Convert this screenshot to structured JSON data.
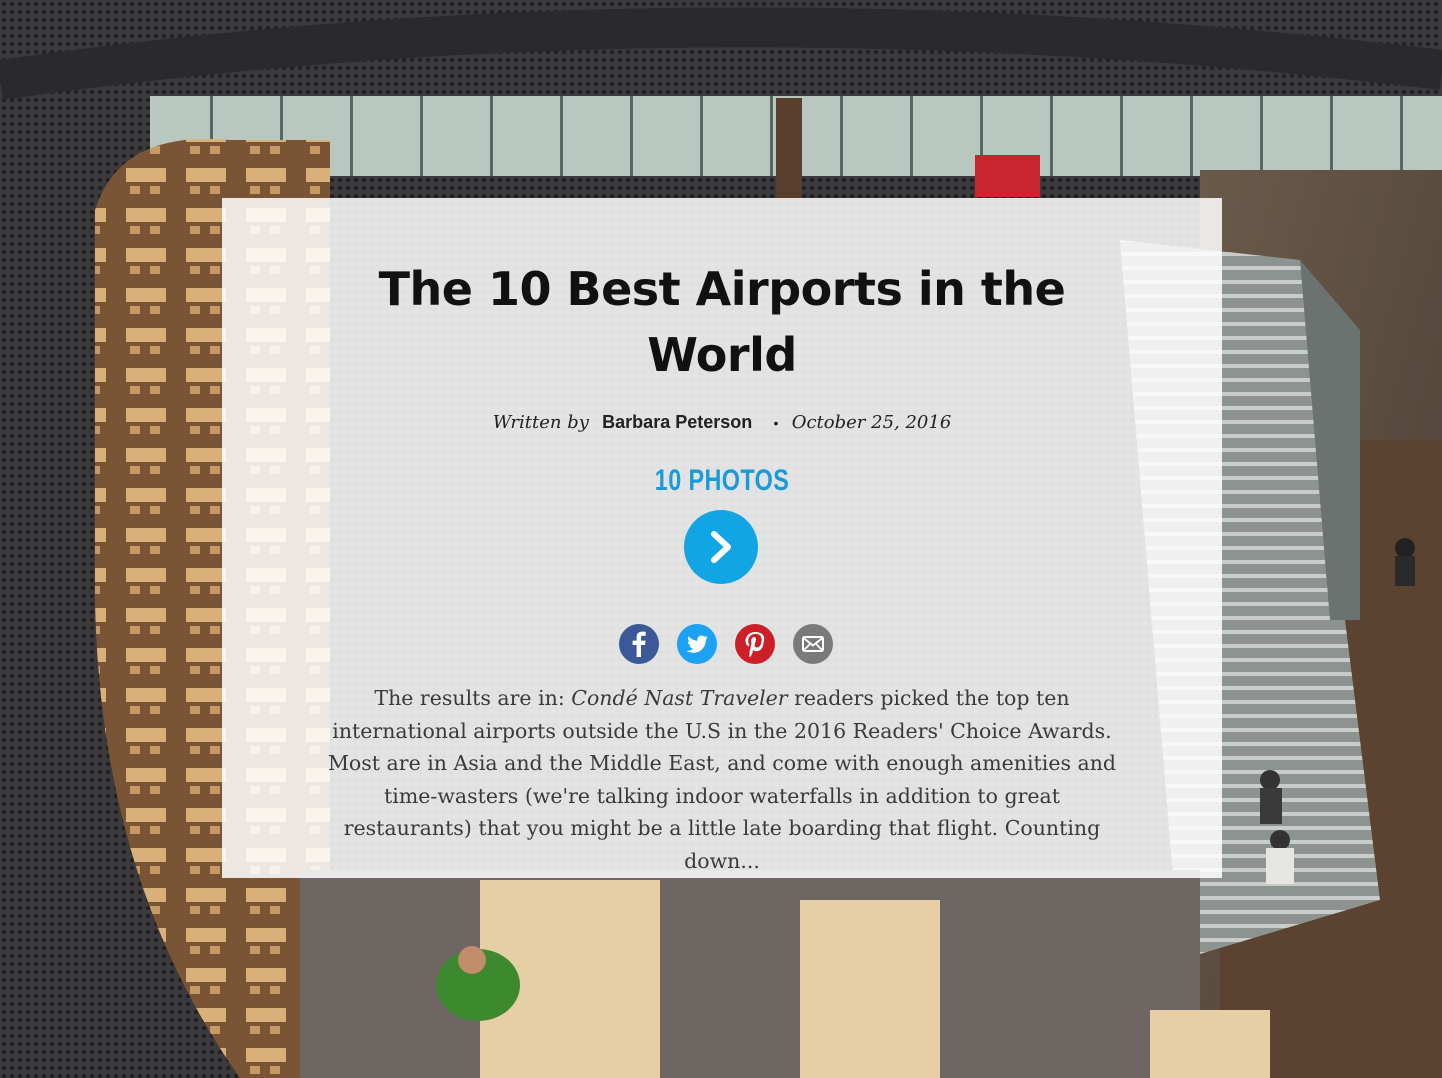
{
  "article": {
    "title": "The 10 Best Airports in the World",
    "byline_prefix": "Written by",
    "author": "Barbara Peterson",
    "separator": "•",
    "date": "October 25, 2016"
  },
  "gallery": {
    "label": "10 PHOTOS",
    "next_icon": "chevron-right-icon"
  },
  "share": {
    "icons": [
      "facebook-icon",
      "twitter-icon",
      "pinterest-icon",
      "email-icon"
    ]
  },
  "intro": {
    "part1": "The results are in: ",
    "publication": "Condé Nast Traveler",
    "part2": " readers picked the top ten international airports outside the U.S in the 2016 Readers' Choice Awards. Most are in Asia and the Middle East, and come with enough amenities and time-wasters (we're talking indoor waterfalls in addition to great restaurants) that you might be a little late boarding that flight. Counting down..."
  },
  "colors": {
    "accent": "#11a6e3",
    "facebook": "#3b5998",
    "twitter": "#1da1f2",
    "pinterest": "#cb2027",
    "email": "#7a7a7a"
  }
}
